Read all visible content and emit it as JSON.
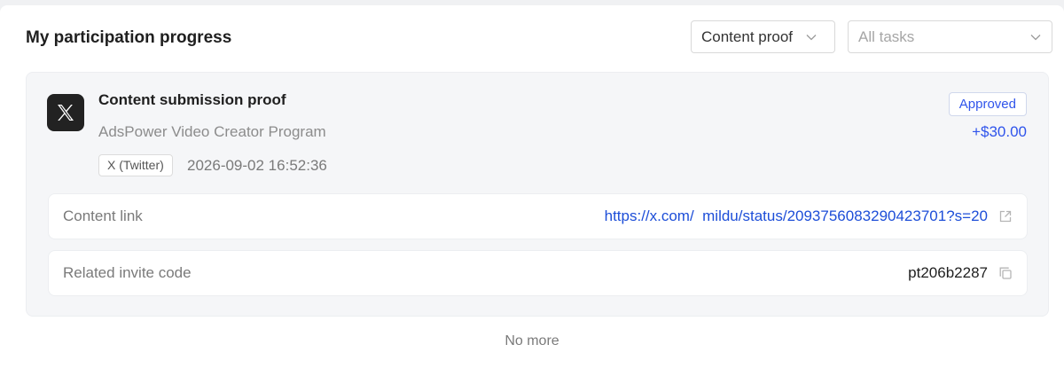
{
  "header": {
    "title": "My participation progress",
    "filter_type": "Content proof",
    "filter_task_placeholder": "All tasks"
  },
  "record": {
    "title": "Content submission proof",
    "program": "AdsPower Video Creator Program",
    "platform": "X (Twitter)",
    "timestamp": "2026-09-02 16:52:36",
    "status": "Approved",
    "reward": "+$30.00",
    "content_link_label": "Content link",
    "content_link": "https://x.com/  mildu/status/2093756083290423701?s=20",
    "invite_label": "Related invite code",
    "invite_code": "pt206b2287"
  },
  "footer": {
    "end_text": "No more"
  },
  "icons": {
    "platform_logo": "x-logo-icon",
    "open_link": "external-link-icon",
    "copy": "copy-icon",
    "dropdown": "chevron-down-icon"
  },
  "colors": {
    "accent": "#2f54eb",
    "link": "#1d4ed8",
    "card_bg": "#f5f6f8"
  }
}
